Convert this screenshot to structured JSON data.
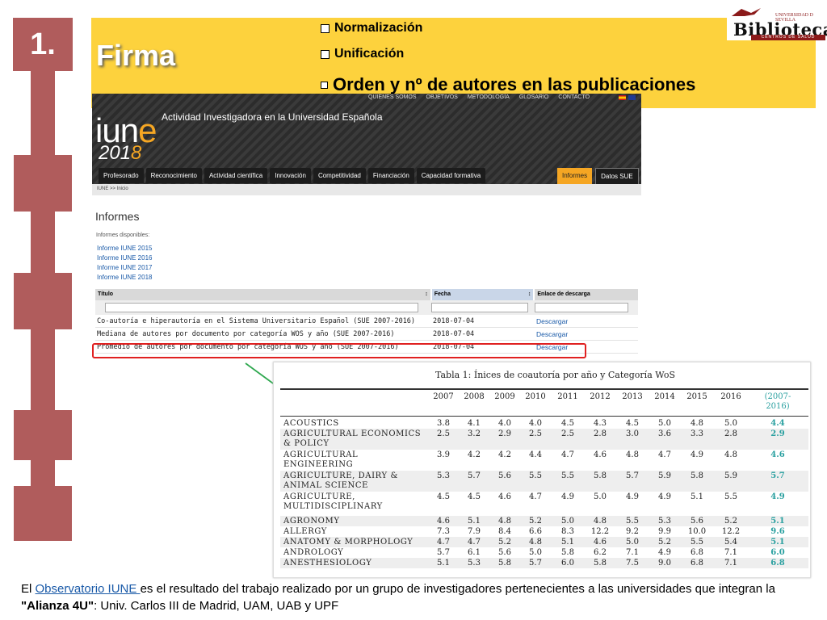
{
  "slide": {
    "number": "1.",
    "title": "Firma",
    "bullets": [
      "Normalización",
      "Unificación",
      "Orden y nº de autores en las publicaciones"
    ]
  },
  "logo": {
    "top": "UNIVERSIDAD D SEVILLA",
    "name": "Biblioteca",
    "sub": "CENTROS DE SALUD",
    "colors": {
      "brand": "#8b1a1a"
    }
  },
  "site": {
    "topnav": [
      "QUIÉNES SOMOS",
      "OBJETIVOS",
      "METODOLOGÍA",
      "GLOSARIO",
      "CONTACTO"
    ],
    "logo_text": "iun",
    "logo_tail": "e",
    "year_main": "201",
    "year_tail": "8",
    "title": "Actividad Investigadora en la Universidad Española",
    "mainnav": [
      "Profesorado",
      "Reconocimiento",
      "Actividad científica",
      "Innovación",
      "Competitividad",
      "Financiación",
      "Capacidad formativa"
    ],
    "informes_tab": "Informes",
    "datos_tab": "Datos SUE",
    "breadcrumb": "IUNE >> Inicio",
    "heading": "Informes",
    "available_label": "Informes disponibles:",
    "reports": [
      "Informe IUNE 2015",
      "Informe IUNE 2016",
      "Informe IUNE 2017",
      "Informe IUNE 2018"
    ],
    "table": {
      "headers": [
        "Título",
        "Fecha",
        "Enlace de descarga"
      ],
      "sort_icon": "↕",
      "rows": [
        {
          "title": "Co-autoría e hiperautoría en el Sistema Universitario Español (SUE 2007-2016)",
          "date": "2018-07-04",
          "link": "Descargar"
        },
        {
          "title": "Mediana de autores por documento por categoría WOS y año (SUE 2007-2016)",
          "date": "2018-07-04",
          "link": "Descargar"
        },
        {
          "title": "Promedio de autores por documento por categoría WOS y año (SUE 2007-2016)",
          "date": "2018-07-04",
          "link": "Descargar"
        }
      ]
    }
  },
  "paper": {
    "caption": "Tabla 1: Ínices de coautoría por año y Categoría WoS",
    "columns": [
      "2007",
      "2008",
      "2009",
      "2010",
      "2011",
      "2012",
      "2013",
      "2014",
      "2015",
      "2016",
      "(2007-",
      "2016)"
    ],
    "rows": [
      {
        "name1": "ACOUSTICS",
        "name2": "",
        "vals": [
          "3.8",
          "4.1",
          "4.0",
          "4.0",
          "4.5",
          "4.3",
          "4.5",
          "5.0",
          "4.8",
          "5.0",
          "4.4"
        ]
      },
      {
        "name1": "AGRICULTURAL ECONOMICS",
        "name2": "& POLICY",
        "vals": [
          "2.5",
          "3.2",
          "2.9",
          "2.5",
          "2.5",
          "2.8",
          "3.0",
          "3.6",
          "3.3",
          "2.8",
          "2.9"
        ]
      },
      {
        "name1": "AGRICULTURAL",
        "name2": "ENGINEERING",
        "vals": [
          "3.9",
          "4.2",
          "4.2",
          "4.4",
          "4.7",
          "4.6",
          "4.8",
          "4.7",
          "4.9",
          "4.8",
          "4.6"
        ]
      },
      {
        "name1": "AGRICULTURE, DAIRY &",
        "name2": "ANIMAL SCIENCE",
        "vals": [
          "5.3",
          "5.7",
          "5.6",
          "5.5",
          "5.5",
          "5.8",
          "5.7",
          "5.9",
          "5.8",
          "5.9",
          "5.7"
        ]
      },
      {
        "name1": "AGRICULTURE,",
        "name2": "MULTIDISCIPLINARY",
        "vals": [
          "4.5",
          "4.5",
          "4.6",
          "4.7",
          "4.9",
          "5.0",
          "4.9",
          "4.9",
          "5.1",
          "5.5",
          "4.9"
        ]
      },
      {
        "name1": "AGRONOMY",
        "name2": "",
        "vals": [
          "4.6",
          "5.1",
          "4.8",
          "5.2",
          "5.0",
          "4.8",
          "5.5",
          "5.3",
          "5.6",
          "5.2",
          "5.1"
        ]
      },
      {
        "name1": "ALLERGY",
        "name2": "",
        "vals": [
          "7.3",
          "7.9",
          "8.4",
          "6.6",
          "8.3",
          "12.2",
          "9.2",
          "9.9",
          "10.0",
          "12.2",
          "9.6"
        ]
      },
      {
        "name1": "ANATOMY & MORPHOLOGY",
        "name2": "",
        "vals": [
          "4.7",
          "4.7",
          "5.2",
          "4.8",
          "5.1",
          "4.6",
          "5.0",
          "5.2",
          "5.5",
          "5.4",
          "5.1"
        ]
      },
      {
        "name1": "ANDROLOGY",
        "name2": "",
        "vals": [
          "5.7",
          "6.1",
          "5.6",
          "5.0",
          "5.8",
          "6.2",
          "7.1",
          "4.9",
          "6.8",
          "7.1",
          "6.0"
        ]
      },
      {
        "name1": "ANESTHESIOLOGY",
        "name2": "",
        "vals": [
          "5.1",
          "5.3",
          "5.8",
          "5.7",
          "6.0",
          "5.8",
          "7.5",
          "9.0",
          "6.8",
          "7.1",
          "6.8"
        ]
      }
    ]
  },
  "footer": {
    "pre": "El ",
    "link": "Observatorio IUNE ",
    "mid": "es el resultado del trabajo realizado por un grupo de investigadores pertenecientes a las universidades que integran la ",
    "bold": "\"Alianza 4U\"",
    "post": ": Univ. Carlos III de Madrid, UAM, UAB y UPF"
  },
  "colors": {
    "timeline": "#b05c5c",
    "header": "#fdd23d",
    "accent": "#f5a623",
    "link": "#1a5aa8",
    "highlight": "#e02020",
    "arrow": "#2fa84f",
    "teal": "#2aa0a0"
  }
}
